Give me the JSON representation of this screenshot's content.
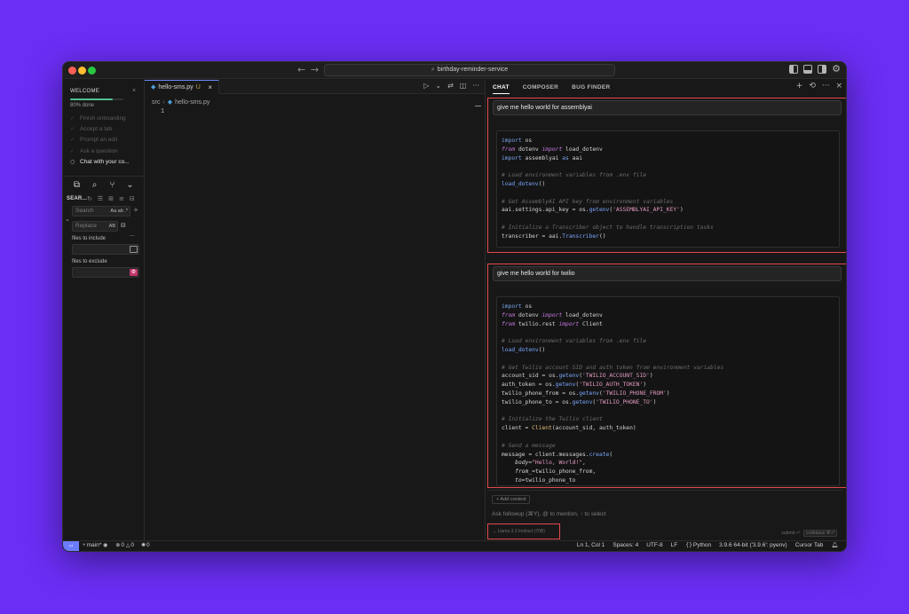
{
  "titlebar": {
    "search_text": "birthday-reminder-service"
  },
  "sidebar": {
    "welcome_title": "WELCOME",
    "progress_percent": 80,
    "progress_text": "80% done",
    "checklist": [
      {
        "label": "Finish onboarding",
        "done": true
      },
      {
        "label": "Accept a tab",
        "done": true
      },
      {
        "label": "Prompt an edit",
        "done": true
      },
      {
        "label": "Ask a question",
        "done": true
      },
      {
        "label": "Chat with your co...",
        "done": false
      }
    ],
    "search_title": "SEAR...",
    "search_placeholder": "Search",
    "search_opts": "Aa ab .*",
    "replace_placeholder": "Replace",
    "replace_opts": "AB",
    "files_include_label": "files to include",
    "files_exclude_label": "files to exclude"
  },
  "editor": {
    "tab_name": "hello-sms.py",
    "tab_status": "U",
    "breadcrumb_folder": "src",
    "breadcrumb_file": "hello-sms.py",
    "line_number": "1"
  },
  "chat": {
    "tabs": [
      "CHAT",
      "COMPOSER",
      "BUG FINDER"
    ],
    "messages": [
      {
        "prompt": "give me hello world for assemblyai"
      },
      {
        "prompt": "give me hello world for twilio"
      }
    ],
    "add_context": "+ Add context",
    "followup_placeholder": "Ask followup (⌘Y), @ to mention, ↑ to select",
    "model": "⌄ Llama 3.3 Instruct (70B)",
    "submit_hint": "submit ⏎",
    "codebase_chip": "codebase ⌘⏎"
  },
  "statusbar": {
    "branch": "main*",
    "errors": "0",
    "warnings": "0",
    "ports": "0",
    "position": "Ln 1, Col 1",
    "spaces": "Spaces: 4",
    "encoding": "UTF-8",
    "eol": "LF",
    "language": "Python",
    "interpreter": "3.9.6 64-bit ('3.9.6': pyenv)",
    "cursor_tab": "Cursor Tab"
  },
  "colors": {
    "background": "#6b2ef5",
    "highlight_box": "#e5484d",
    "accent": "#6b7cff"
  }
}
